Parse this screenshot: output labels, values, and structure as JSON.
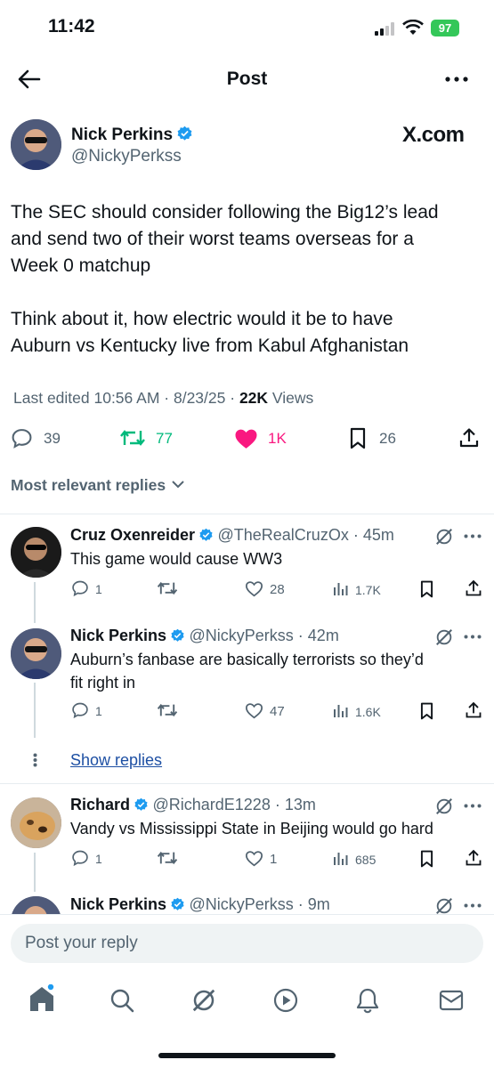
{
  "status_bar": {
    "time": "11:42",
    "battery": "97"
  },
  "header": {
    "title": "Post"
  },
  "post": {
    "author_name": "Nick Perkins",
    "author_handle": "@NickyPerkss",
    "source": "X.com",
    "text_line1": "The SEC should consider following the Big12’s lead",
    "text_line2": "and send two of their worst teams overseas for a",
    "text_line3": "Week 0 matchup",
    "text_line4": "Think about it, how electric would it be to have",
    "text_line5": "Auburn vs Kentucky live from Kabul Afghanistan",
    "edited": "Last edited 10:56 AM · 8/23/25",
    "views_count": "22K",
    "views_label": "Views",
    "replies": "39",
    "reposts": "77",
    "likes": "1K",
    "bookmarks": "26"
  },
  "filter": {
    "label": "Most relevant replies"
  },
  "replies": [
    {
      "name": "Cruz Oxenreider",
      "handle": "@TheRealCruzOx",
      "time": "45m",
      "text": "This game would cause WW3",
      "replies": "1",
      "reposts": "",
      "likes": "28",
      "views": "1.7K"
    },
    {
      "name": "Nick Perkins",
      "handle": "@NickyPerkss",
      "time": "42m",
      "text_line1": "Auburn’s fanbase are basically terrorists so they’d",
      "text_line2": "fit right in",
      "replies": "1",
      "reposts": "",
      "likes": "47",
      "views": "1.6K"
    },
    {
      "name": "Richard",
      "handle": "@RichardE1228",
      "time": "13m",
      "text": "Vandy vs Mississippi State in Beijing would go hard",
      "replies": "1",
      "reposts": "",
      "likes": "1",
      "views": "685"
    },
    {
      "name": "Nick Perkins",
      "handle": "@NickyPerkss",
      "time": "9m"
    }
  ],
  "show_replies": "Show replies",
  "reply_box": {
    "placeholder": "Post your reply"
  },
  "colors": {
    "verified": "#1d9bf0",
    "repost": "#00ba7c",
    "like": "#f91880",
    "text": "#0f1419",
    "muted": "#536471"
  },
  "icons": {
    "back": "arrow-left-icon",
    "more": "more-icon",
    "home": "home-icon",
    "search": "search-icon",
    "grok": "grok-icon",
    "video": "play-icon",
    "notifications": "bell-icon",
    "messages": "envelope-icon"
  }
}
